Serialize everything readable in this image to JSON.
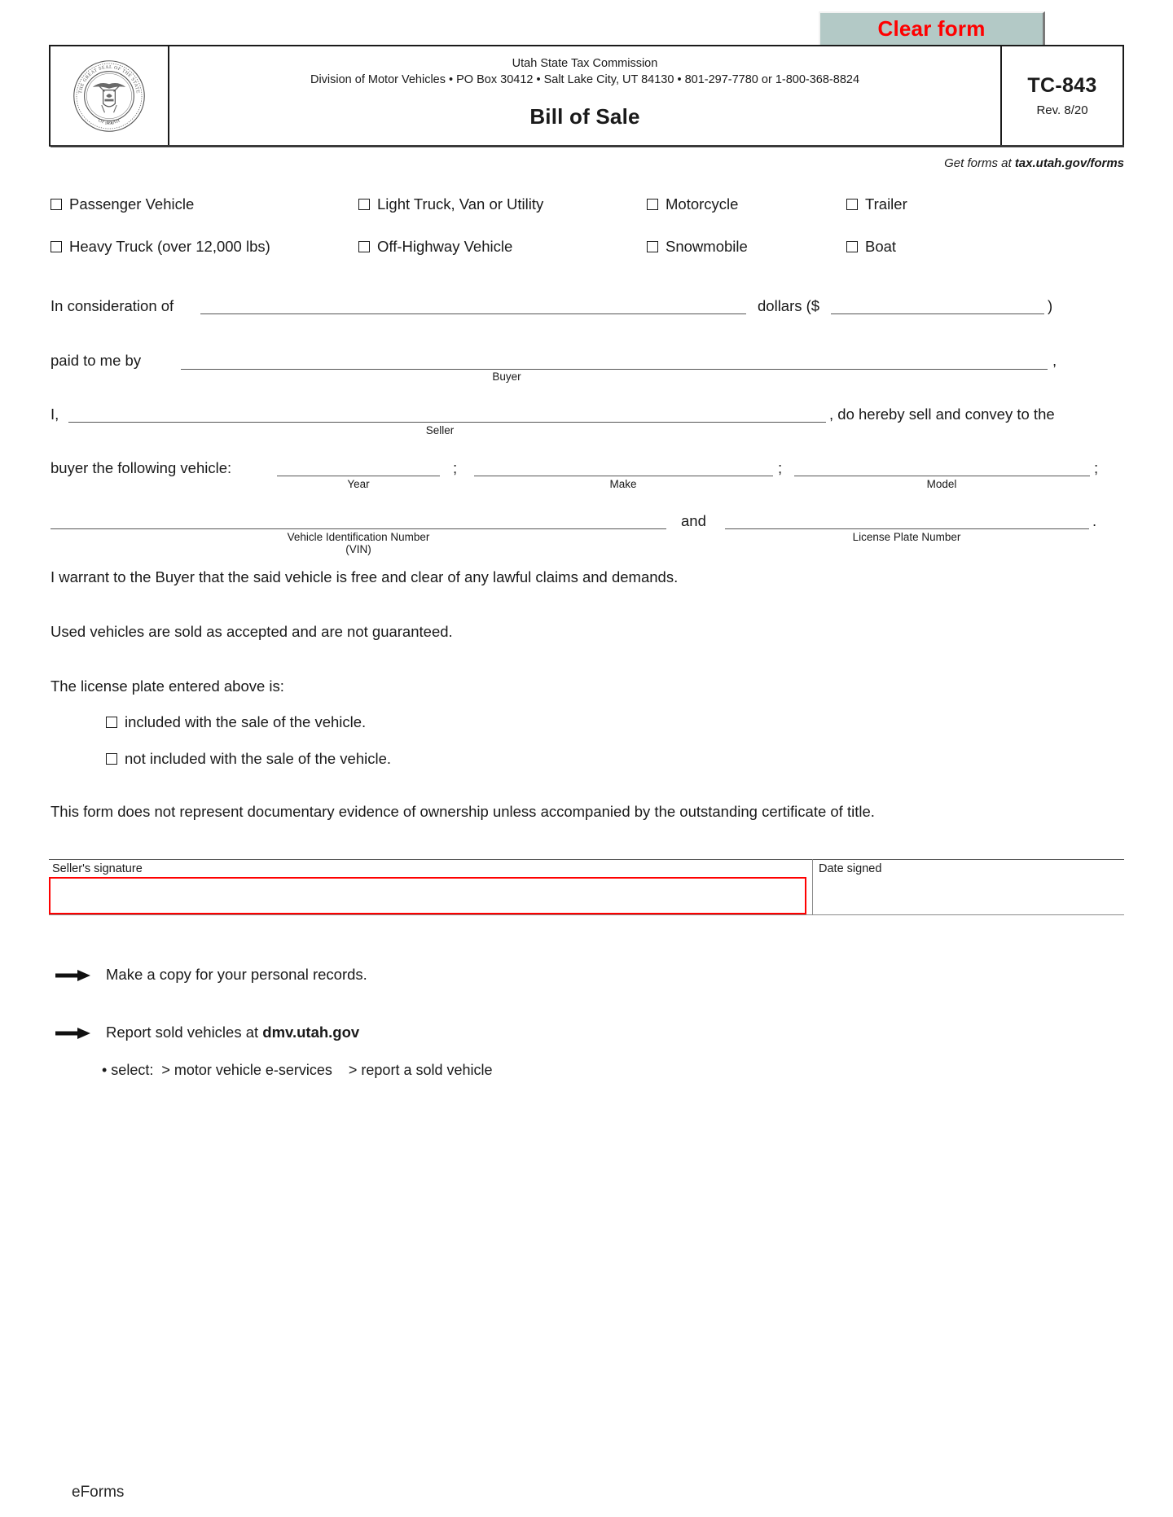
{
  "toolbar": {
    "clear_form_label": "Clear form"
  },
  "header": {
    "agency_name": "Utah State Tax Commission",
    "agency_address": "Division of Motor Vehicles  •  PO Box 30412  •  Salt Lake City, UT 84130  •  801-297-7780 or 1-800-368-8824",
    "form_title": "Bill of Sale",
    "form_code": "TC-843",
    "form_revision": "Rev. 8/20",
    "seal_outer_text": "THE GREAT SEAL OF THE STATE OF UTAH",
    "seal_year": "1896",
    "get_forms_prefix": "Get forms at ",
    "get_forms_link": "tax.utah.gov/forms"
  },
  "vehicle_types": {
    "row1": [
      {
        "label": "Passenger Vehicle",
        "checked": false
      },
      {
        "label": "Light Truck, Van or Utility",
        "checked": false
      },
      {
        "label": "Motorcycle",
        "checked": false
      },
      {
        "label": "Trailer",
        "checked": false
      }
    ],
    "row2": [
      {
        "label": "Heavy Truck (over 12,000 lbs)",
        "checked": false
      },
      {
        "label": "Off-Highway Vehicle",
        "checked": false
      },
      {
        "label": "Snowmobile",
        "checked": false
      },
      {
        "label": "Boat",
        "checked": false
      }
    ]
  },
  "consideration": {
    "lead_text": "In consideration of",
    "amount_words_value": "",
    "dollars_text": "dollars ($",
    "amount_value": "",
    "close_paren": ")"
  },
  "paid_to": {
    "lead_text": "paid to me by",
    "buyer_value": "",
    "buyer_caption": "Buyer",
    "trailing_comma": ","
  },
  "seller_line": {
    "lead_text": "I,",
    "seller_value": "",
    "seller_caption": "Seller",
    "trailing_text": ", do hereby sell and convey to the"
  },
  "vehicle_line": {
    "lead_text": "buyer the following vehicle:",
    "year_value": "",
    "year_caption": "Year",
    "semicolon1": ";",
    "make_value": "",
    "make_caption": "Make",
    "semicolon2": ";",
    "model_value": "",
    "model_caption": "Model",
    "semicolon3": ";"
  },
  "vin_line": {
    "vin_value": "",
    "vin_caption": "Vehicle Identification Number (VIN)",
    "and_text": "and",
    "plate_value": "",
    "plate_caption": "License Plate Number",
    "period": "."
  },
  "statements": {
    "warranty": "I warrant to the Buyer that the said vehicle is free and clear of any lawful claims and demands.",
    "used_vehicles": "Used vehicles are sold as accepted and are not guaranteed.",
    "plate_prompt": "The license plate entered above is:",
    "plate_included": "included with the sale of the vehicle.",
    "plate_not_included": "not included with the sale of the vehicle.",
    "ownership_notice": "This form does not represent documentary evidence of ownership unless accompanied by the outstanding certificate of title."
  },
  "signature": {
    "seller_signature_label": "Seller's signature",
    "seller_signature_value": "",
    "date_signed_label": "Date signed",
    "date_signed_value": ""
  },
  "instructions": {
    "copy_note": "Make a copy for your personal records.",
    "report_prefix": "Report sold vehicles at ",
    "report_link": "dmv.utah.gov",
    "bullet": "• select:  > motor vehicle e-services    > report a sold vehicle"
  },
  "footer": {
    "label": "eForms"
  },
  "colors": {
    "clear_form_text": "#ff0000",
    "clear_form_bg": "#b3c9c6",
    "active_field_border": "#ff0000",
    "text": "#1a1a1a"
  }
}
